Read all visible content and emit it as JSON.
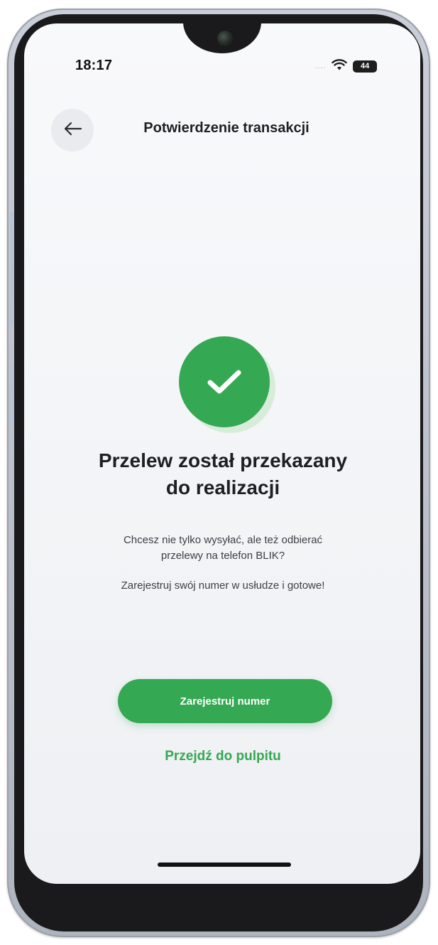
{
  "status_bar": {
    "time": "18:17",
    "signal_dots": "....",
    "battery_level": "44",
    "wifi_icon": "wifi-icon"
  },
  "header": {
    "title": "Potwierdzenie transakcji",
    "back_icon": "arrow-left-icon"
  },
  "confirmation": {
    "icon": "check-circle-icon",
    "accent_color": "#35a853",
    "headline_line1": "Przelew został przekazany",
    "headline_line2": "do realizacji",
    "description_line1": "Chcesz nie tylko wysyłać, ale też odbierać",
    "description_line2": "przelewy na telefon BLIK?",
    "description_2": "Zarejestruj swój numer w usłudze i gotowe!"
  },
  "actions": {
    "primary_label": "Zarejestruj numer",
    "secondary_label": "Przejdź do pulpitu"
  }
}
